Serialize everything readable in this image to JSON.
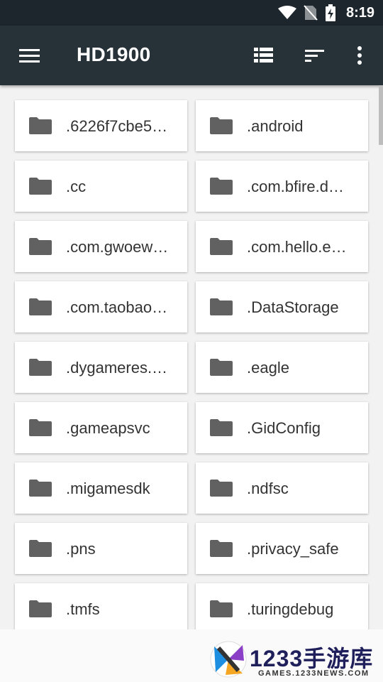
{
  "status_bar": {
    "time": "8:19",
    "icons": [
      "wifi-icon",
      "no-sim-icon",
      "battery-charging-icon"
    ]
  },
  "toolbar": {
    "title": "HD1900",
    "menu_icon": "hamburger-menu-icon",
    "actions": [
      "list-view-icon",
      "sort-icon",
      "more-vert-icon"
    ]
  },
  "folders": [
    {
      "name": ".6226f7cbe5…"
    },
    {
      "name": ".android"
    },
    {
      "name": ".cc"
    },
    {
      "name": ".com.bfire.d…"
    },
    {
      "name": ".com.gwoew…"
    },
    {
      "name": ".com.hello.e…"
    },
    {
      "name": ".com.taobao…"
    },
    {
      "name": ".DataStorage"
    },
    {
      "name": ".dygameres.…"
    },
    {
      "name": ".eagle"
    },
    {
      "name": ".gameapsvc"
    },
    {
      "name": ".GidConfig"
    },
    {
      "name": ".migamesdk"
    },
    {
      "name": ".ndfsc"
    },
    {
      "name": ".pns"
    },
    {
      "name": ".privacy_safe"
    },
    {
      "name": ".tmfs"
    },
    {
      "name": ".turingdebug"
    }
  ],
  "watermark": {
    "brand": "1233手游库",
    "url": "GAMES.1233NEWS.COM"
  },
  "colors": {
    "toolbar": "#263238",
    "status_bar": "#1d262c",
    "folder_icon": "#616161",
    "background": "#f2f2f2"
  }
}
